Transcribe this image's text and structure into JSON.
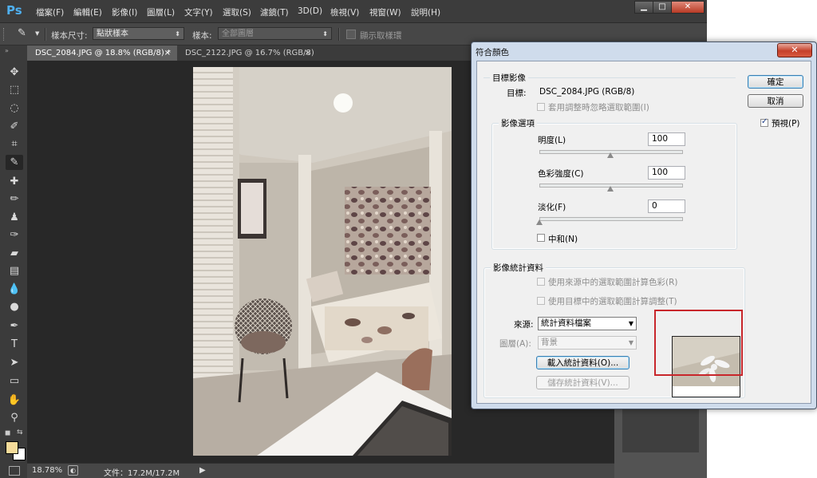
{
  "app": {
    "logo": "Ps",
    "menu": [
      "檔案(F)",
      "編輯(E)",
      "影像(I)",
      "圖層(L)",
      "文字(Y)",
      "選取(S)",
      "濾鏡(T)",
      "3D(D)",
      "檢視(V)",
      "視窗(W)",
      "說明(H)"
    ],
    "window_controls": [
      "▁",
      "□",
      "✕"
    ]
  },
  "options_bar": {
    "sample_size_label": "樣本尺寸:",
    "sample_size_value": "點狀樣本",
    "sample_label": "樣本:",
    "sample_value": "全部圖層",
    "show_ring_label": "顯示取樣環"
  },
  "tabs": [
    {
      "label": "DSC_2084.JPG @ 18.8% (RGB/8) *",
      "close": "×"
    },
    {
      "label": "DSC_2122.JPG @ 16.7% (RGB/8)",
      "close": "×"
    }
  ],
  "status_bar": {
    "zoom": "18.78%",
    "file_info": "文件：17.2M/17.2M",
    "arrow": "▶"
  },
  "dialog": {
    "title": "符合顏色",
    "close": "✕",
    "target_group": {
      "title": "目標影像",
      "target_label": "目標:",
      "target_value": "DSC_2084.JPG (RGB/8)",
      "ignore_selection_label": "套用調整時忽略選取範圍(I)"
    },
    "options_group": {
      "title": "影像選項",
      "luminance_label": "明度(L)",
      "luminance_value": "100",
      "luminance_level": 0.5,
      "intensity_label": "色彩強度(C)",
      "intensity_value": "100",
      "intensity_level": 0.5,
      "fade_label": "淡化(F)",
      "fade_value": "0",
      "fade_level": 0.0,
      "neutralize_label": "中和(N)"
    },
    "stats_group": {
      "title": "影像統計資料",
      "use_source_selection_label": "使用來源中的選取範圍計算色彩(R)",
      "use_target_selection_label": "使用目標中的選取範圍計算調整(T)",
      "source_label": "來源:",
      "source_value": "統計資料檔案",
      "layer_label": "圖層(A):",
      "layer_value": "背景",
      "load_button": "載入統計資料(O)...",
      "save_button": "儲存統計資料(V)..."
    },
    "ok_button": "確定",
    "cancel_button": "取消",
    "preview_label": "預視(P)",
    "preview_checked": true
  }
}
